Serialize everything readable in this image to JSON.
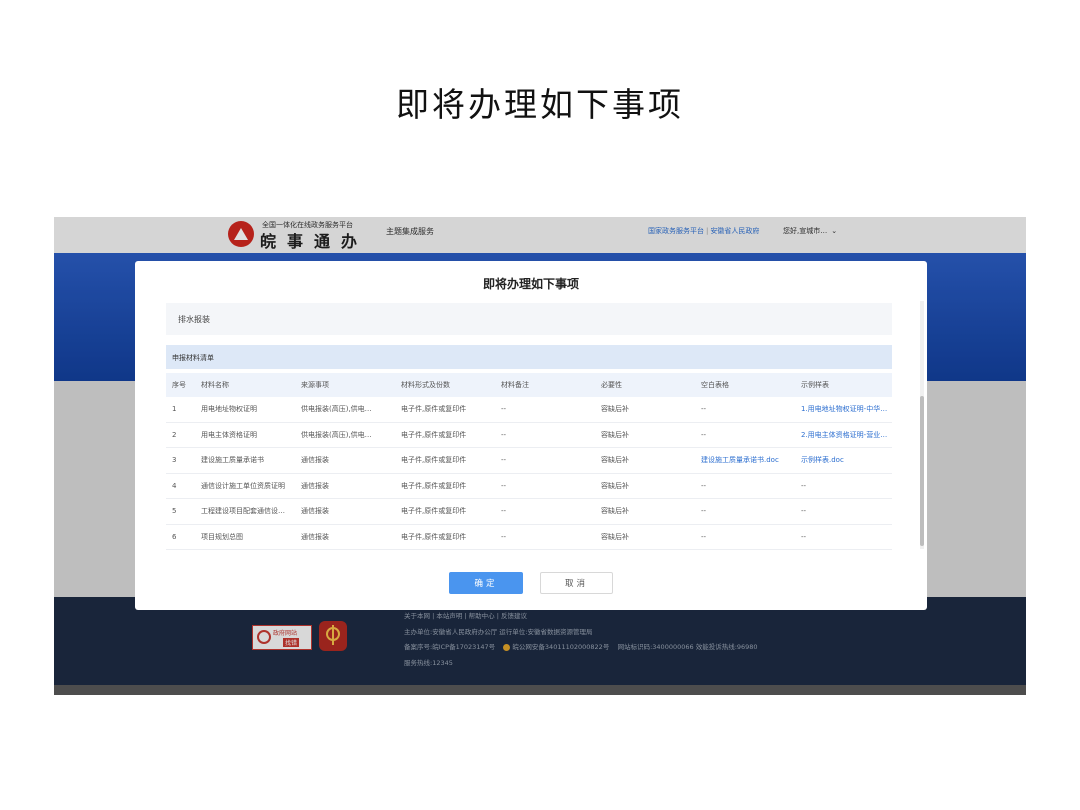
{
  "slide": {
    "title": "即将办理如下事项"
  },
  "header": {
    "logo_subtitle": "全国一体化在线政务服务平台",
    "logo_title": "皖事通办",
    "nav_item": "主题集成服务",
    "link_national": "国家政务服务平台",
    "link_province": "安徽省人民政府",
    "greeting": "您好,宣城市…"
  },
  "modal": {
    "title": "即将办理如下事项",
    "section_title": "排水报装",
    "list_title": "申报材料清单",
    "columns": [
      "序号",
      "材料名称",
      "来源事项",
      "材料形式及份数",
      "材料备注",
      "必要性",
      "空白表格",
      "示例样表"
    ],
    "rows": [
      [
        "1",
        "用电地址物权证明",
        "供电报装(高压),供电…",
        "电子件,原件或复印件",
        "--",
        "容缺后补",
        "--",
        "1.用电地址物权证明-中华…"
      ],
      [
        "2",
        "用电主体资格证明",
        "供电报装(高压),供电…",
        "电子件,原件或复印件",
        "--",
        "容缺后补",
        "--",
        "2.用电主体资格证明-营业…"
      ],
      [
        "3",
        "建设施工质量承诺书",
        "通信报装",
        "电子件,原件或复印件",
        "--",
        "容缺后补",
        "建设施工质量承诺书.doc",
        "示例样表.doc"
      ],
      [
        "4",
        "通信设计施工单位资质证明",
        "通信报装",
        "电子件,原件或复印件",
        "--",
        "容缺后补",
        "--",
        "--"
      ],
      [
        "5",
        "工程建设项目配套通信设…",
        "通信报装",
        "电子件,原件或复印件",
        "--",
        "容缺后补",
        "--",
        "--"
      ],
      [
        "6",
        "项目规划总图",
        "通信报装",
        "电子件,原件或复印件",
        "--",
        "容缺后补",
        "--",
        "--"
      ]
    ],
    "confirm_label": "确定",
    "cancel_label": "取消"
  },
  "footer": {
    "badge_gov_line1": "政府网站",
    "badge_gov_line2": "找错",
    "links": "关于本网 | 本站声明 | 帮助中心 | 反馈建议",
    "org": "主办单位:安徽省人民政府办公厅    运行单位:安徽省数据资源管理局",
    "icp": "备案序号:皖ICP备17023147号",
    "police": "皖公网安备34011102000822号",
    "site_code": "网站标识码:3400000066    效能投诉热线:96980",
    "hotline": "服务热线:12345"
  },
  "colors": {
    "primary": "#4a95ef",
    "link": "#2d6fd0",
    "banner": "#1f4fb0",
    "footer": "#1d2b42"
  }
}
